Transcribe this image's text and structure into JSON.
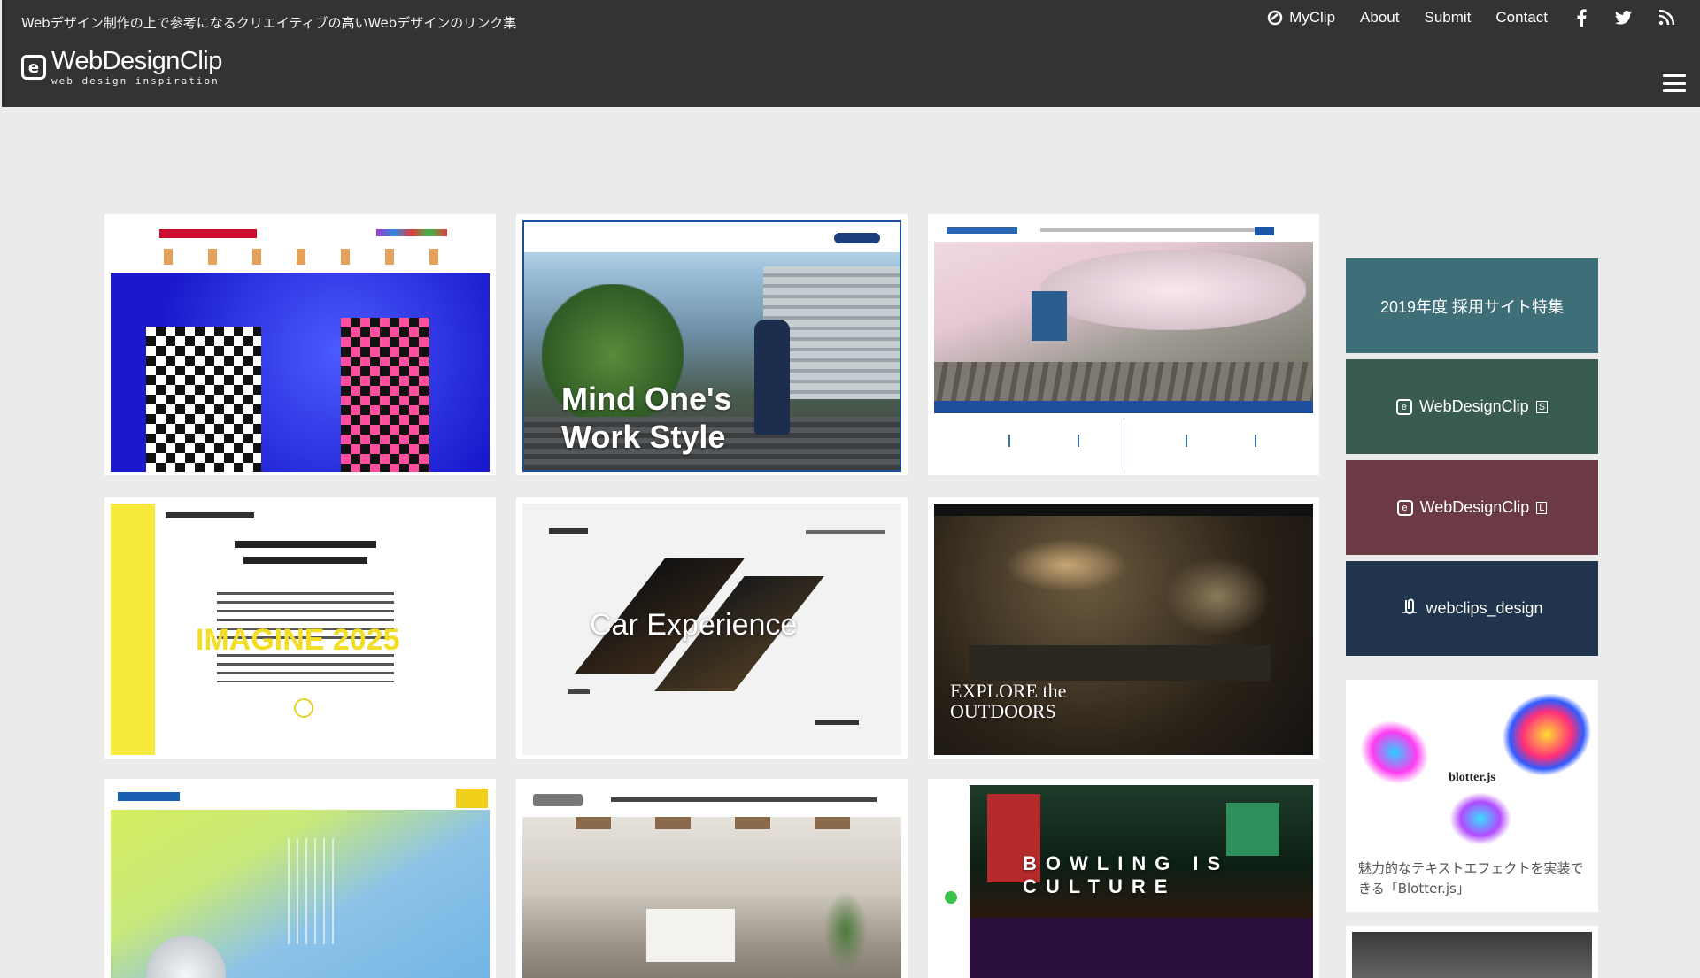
{
  "header": {
    "tagline": "Webデザイン制作の上で参考になるクリエイティブの高いWebデザインのリンク集",
    "logo_name": "WebDesignClip",
    "logo_sub": "web design inspiration",
    "nav": [
      {
        "label": "MyClip",
        "icon": "myclip-icon"
      },
      {
        "label": "About"
      },
      {
        "label": "Submit"
      },
      {
        "label": "Contact"
      }
    ],
    "social": [
      "facebook-icon",
      "twitter-icon",
      "rss-icon"
    ]
  },
  "cards": [
    {
      "caption": ""
    },
    {
      "caption": "Mind One's Work Style"
    },
    {
      "caption": ""
    },
    {
      "caption": "IMAGINE 2025"
    },
    {
      "caption": "Car Experience"
    },
    {
      "caption": "EXPLORE the OUTDOORS"
    },
    {
      "caption": ""
    },
    {
      "caption": ""
    },
    {
      "caption": "BOWLING IS CULTURE"
    }
  ],
  "sidebar": {
    "buttons": [
      {
        "label": "2019年度 採用サイト特集",
        "color": "#3e6e78"
      },
      {
        "label": "WebDesignClip",
        "badge": "S",
        "color": "#385a4f"
      },
      {
        "label": "WebDesignClip",
        "badge": "L",
        "color": "#6b3a44"
      },
      {
        "label": "webclips_design",
        "color": "#20354d"
      }
    ],
    "feature": {
      "image_title": "blotter.js",
      "text": "魅力的なテキストエフェクトを実装できる「Blotter.js」"
    }
  },
  "colors": {
    "header_bg": "#333333",
    "page_bg": "#ebebeb"
  }
}
